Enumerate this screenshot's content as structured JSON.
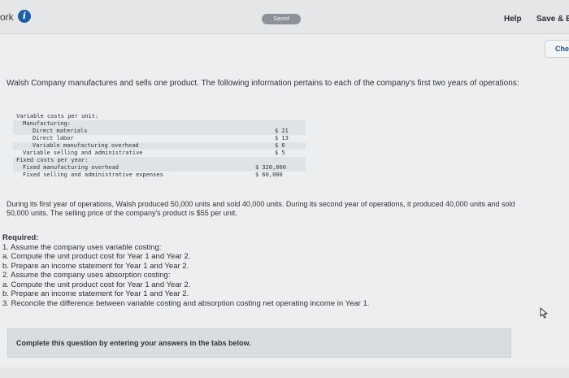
{
  "header": {
    "nav_title": "ork",
    "info_icon": "i",
    "saved_label": "Saved",
    "help_label": "Help",
    "save_exit_label": "Save & E",
    "check_label": "Che"
  },
  "intro": "Walsh Company manufactures and sells one product. The following information pertains to each of the company's first two years of operations:",
  "cost_table": {
    "rows": [
      {
        "label": "Variable costs per unit:",
        "value": ""
      },
      {
        "label": "Manufacturing:",
        "value": ""
      },
      {
        "label": "Direct materials",
        "value": "$ 21"
      },
      {
        "label": "Direct labor",
        "value": "$ 13"
      },
      {
        "label": "Variable manufacturing overhead",
        "value": "$ 6"
      },
      {
        "label": "Variable selling and administrative",
        "value": "$ 5"
      },
      {
        "label": "Fixed costs per year:",
        "value": ""
      },
      {
        "label": "Fixed manufacturing overhead",
        "value": "$ 320,000"
      },
      {
        "label": "Fixed selling and administrative expenses",
        "value": "$ 60,000"
      }
    ]
  },
  "scenario": "During its first year of operations, Walsh produced 50,000 units and sold 40,000 units. During its second year of operations, it produced 40,000 units and sold 50,000 units. The selling price of the company's product is $55 per unit.",
  "required": {
    "heading": "Required:",
    "items": [
      "1. Assume the company uses variable costing:",
      "a. Compute the unit product cost for Year 1 and Year 2.",
      "b. Prepare an income statement for Year 1 and Year 2.",
      "2. Assume the company uses absorption costing:",
      "a. Compute the unit product cost for Year 1 and Year 2.",
      "b. Prepare an income statement for Year 1 and Year 2.",
      "3. Reconcile the difference between variable costing and absorption costing net operating income in Year 1."
    ]
  },
  "complete_prompt": "Complete this question by entering your answers in the tabs below.",
  "icons": {
    "info": "info-icon",
    "cursor": "mouse-pointer-icon"
  }
}
